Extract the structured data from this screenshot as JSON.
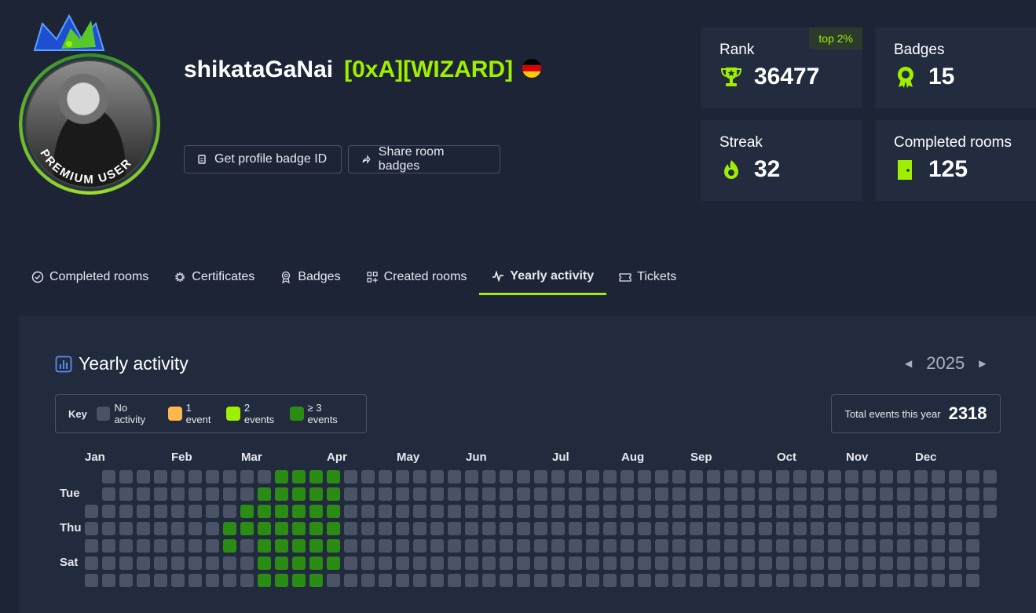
{
  "profile": {
    "username": "shikataGaNai",
    "rank_title": "[0xA][WIZARD]",
    "premium_label": "PREMIUM USER",
    "flag": "germany-flag"
  },
  "buttons": {
    "profile_badge": "Get profile badge ID",
    "share_badges": "Share room badges"
  },
  "stats": {
    "rank": {
      "label": "Rank",
      "value": "36477",
      "badge": "top 2%",
      "icon": "trophy-icon"
    },
    "badges": {
      "label": "Badges",
      "value": "15",
      "icon": "rosette-icon"
    },
    "streak": {
      "label": "Streak",
      "value": "32",
      "icon": "flame-icon"
    },
    "completed": {
      "label": "Completed rooms",
      "value": "125",
      "icon": "door-icon"
    }
  },
  "tabs": [
    {
      "label": "Completed rooms",
      "icon": "check-circle-icon"
    },
    {
      "label": "Certificates",
      "icon": "gear-icon"
    },
    {
      "label": "Badges",
      "icon": "medal-icon"
    },
    {
      "label": "Created rooms",
      "icon": "grid-plus-icon"
    },
    {
      "label": "Yearly activity",
      "icon": "activity-icon",
      "active": true
    },
    {
      "label": "Tickets",
      "icon": "ticket-icon"
    }
  ],
  "activity": {
    "title": "Yearly activity",
    "year": "2025",
    "key_label": "Key",
    "legend": [
      {
        "label": "No activity",
        "color": "#4a5366"
      },
      {
        "label": "1 event",
        "color": "#ffb84d"
      },
      {
        "label": "2 events",
        "color": "#9fef00"
      },
      {
        "label": "≥ 3 events",
        "color": "#2a8c12"
      }
    ],
    "total_label": "Total events this year",
    "total_value": "2318",
    "months": [
      "Jan",
      "Feb",
      "Mar",
      "Apr",
      "May",
      "Jun",
      "Jul",
      "Aug",
      "Sep",
      "Oct",
      "Nov",
      "Dec"
    ],
    "day_labels": [
      "Tue",
      "Thu",
      "Sat"
    ],
    "weeks": 53,
    "active_level3_days": [
      [
        11,
        0
      ],
      [
        12,
        0
      ],
      [
        13,
        0
      ],
      [
        14,
        0
      ],
      [
        10,
        1
      ],
      [
        11,
        1
      ],
      [
        12,
        1
      ],
      [
        13,
        1
      ],
      [
        14,
        1
      ],
      [
        9,
        2
      ],
      [
        10,
        2
      ],
      [
        11,
        2
      ],
      [
        12,
        2
      ],
      [
        13,
        2
      ],
      [
        14,
        2
      ],
      [
        8,
        3
      ],
      [
        9,
        3
      ],
      [
        10,
        3
      ],
      [
        11,
        3
      ],
      [
        12,
        3
      ],
      [
        13,
        3
      ],
      [
        14,
        3
      ],
      [
        8,
        4
      ],
      [
        10,
        4
      ],
      [
        11,
        4
      ],
      [
        12,
        4
      ],
      [
        13,
        4
      ],
      [
        14,
        4
      ],
      [
        10,
        5
      ],
      [
        11,
        5
      ],
      [
        12,
        5
      ],
      [
        13,
        5
      ],
      [
        14,
        5
      ],
      [
        10,
        6
      ],
      [
        11,
        6
      ],
      [
        12,
        6
      ],
      [
        13,
        6
      ]
    ]
  }
}
